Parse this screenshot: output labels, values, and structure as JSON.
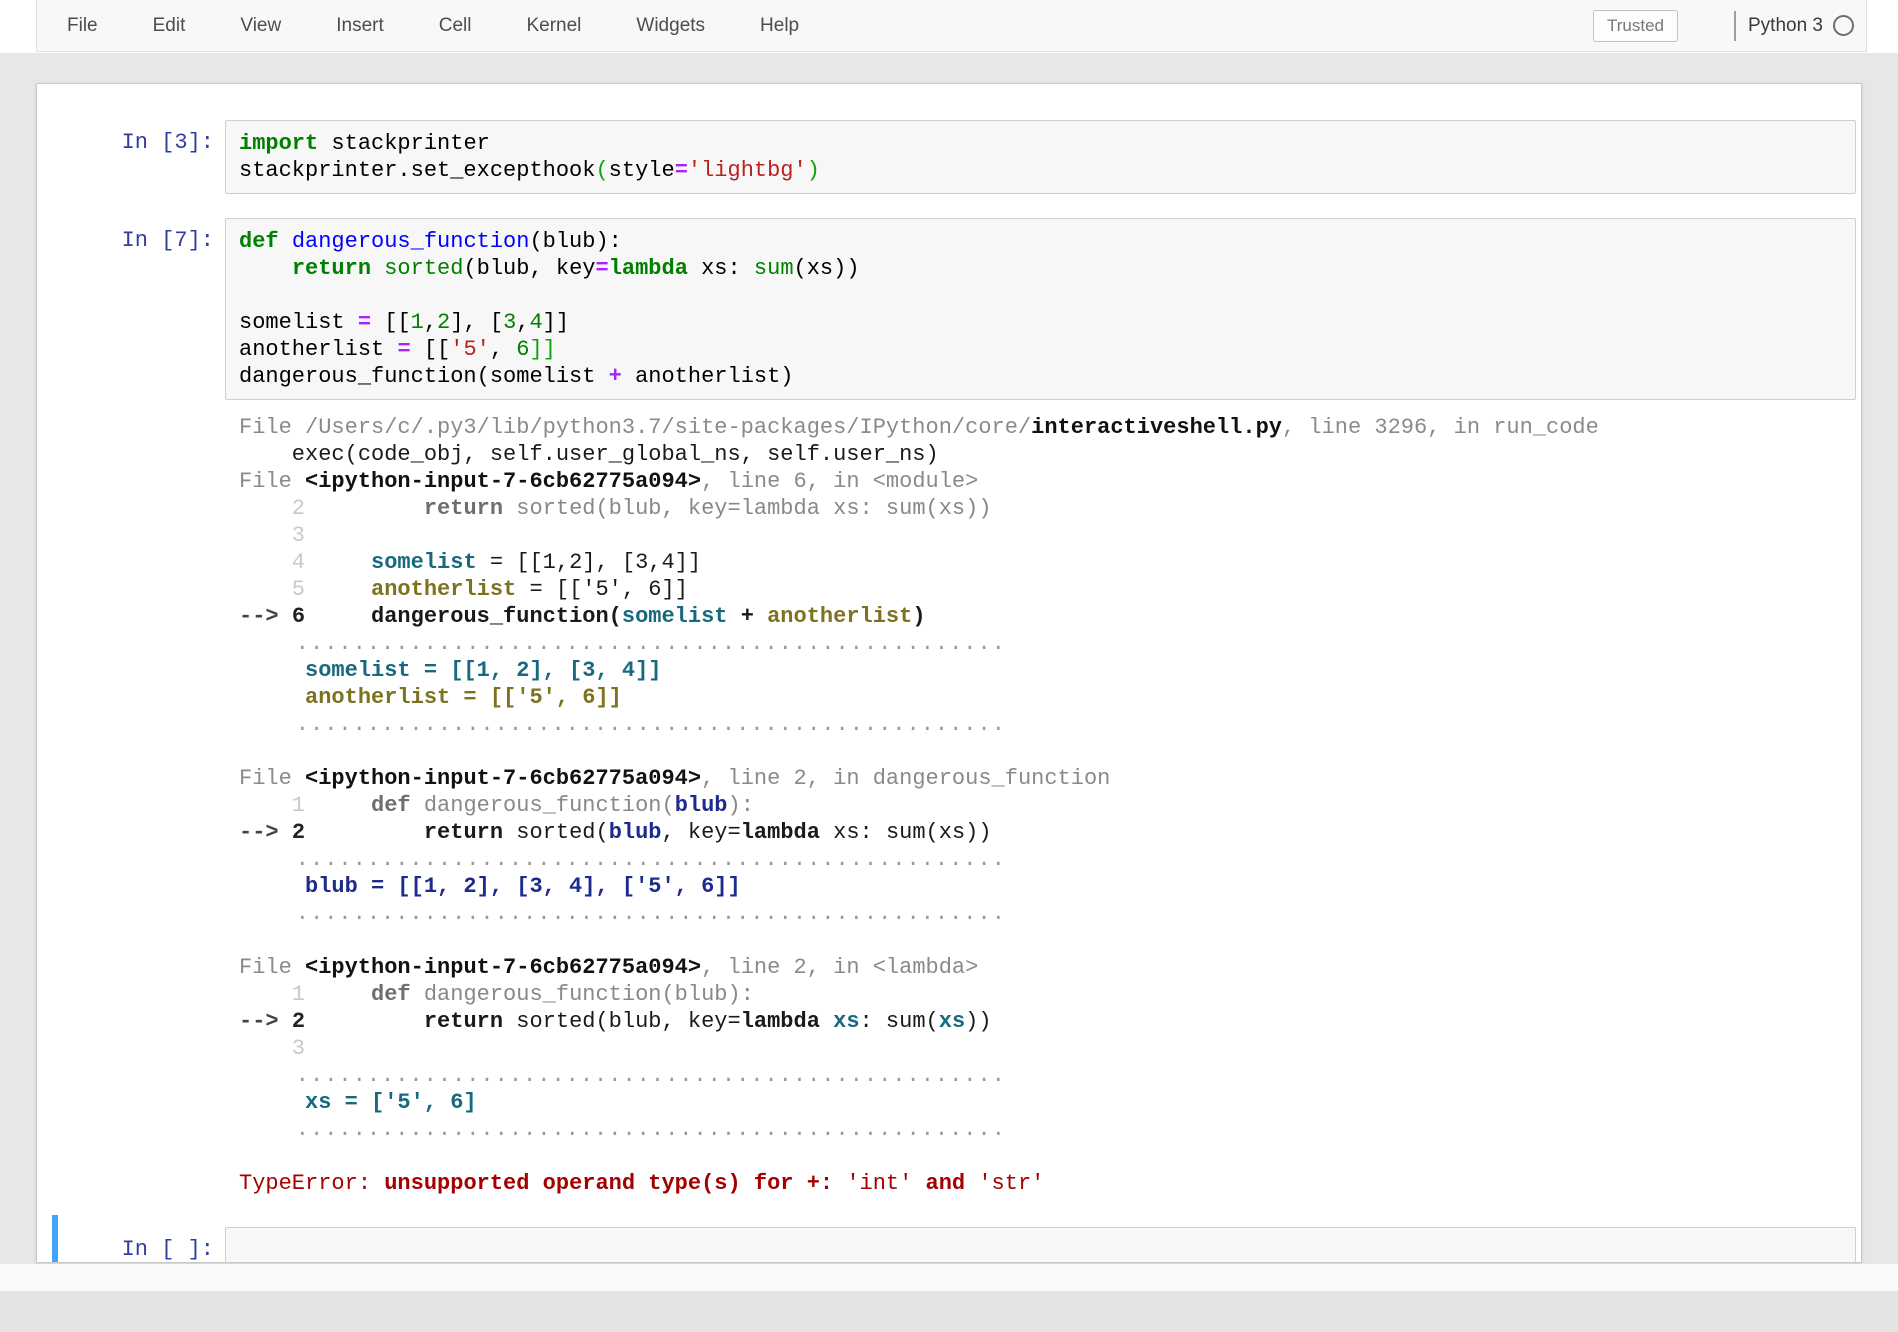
{
  "menubar": {
    "items": [
      {
        "id": "file",
        "label": "File"
      },
      {
        "id": "edit",
        "label": "Edit"
      },
      {
        "id": "view",
        "label": "View"
      },
      {
        "id": "insert",
        "label": "Insert"
      },
      {
        "id": "cell",
        "label": "Cell"
      },
      {
        "id": "kernel",
        "label": "Kernel"
      },
      {
        "id": "widgets",
        "label": "Widgets"
      },
      {
        "id": "help",
        "label": "Help"
      }
    ],
    "trusted_label": "Trusted",
    "kernel_name": "Python 3"
  },
  "colors": {
    "selected_cell_bar": "#42a5f5",
    "prompt_blue": "#303f9f",
    "keyword_green": "#008000",
    "string_red": "#ba2121",
    "operator_purple": "#aa22ff",
    "var_teal": "#17697d",
    "var_olive": "#7d721e",
    "var_navy": "#1c2b8d",
    "error_red": "#a40000"
  },
  "cells": [
    {
      "prompt": "In [3]:",
      "code": [
        [
          [
            "kw",
            "import"
          ],
          [
            "p",
            " stackprinter"
          ]
        ],
        [
          [
            "p",
            "stackprinter.set_excepthook"
          ],
          [
            "mb",
            "("
          ],
          [
            "p",
            "style"
          ],
          [
            "op",
            "="
          ],
          [
            "str",
            "'lightbg'"
          ],
          [
            "mb",
            ")"
          ]
        ]
      ]
    },
    {
      "prompt": "In [7]:",
      "code": [
        [
          [
            "kw",
            "def"
          ],
          [
            "p",
            " "
          ],
          [
            "fn",
            "dangerous_function"
          ],
          [
            "p",
            "(blub):"
          ]
        ],
        [
          [
            "p",
            "    "
          ],
          [
            "kw",
            "return"
          ],
          [
            "p",
            " "
          ],
          [
            "bi",
            "sorted"
          ],
          [
            "p",
            "(blub, key"
          ],
          [
            "op",
            "="
          ],
          [
            "kw",
            "lambda"
          ],
          [
            "p",
            " xs: "
          ],
          [
            "bi",
            "sum"
          ],
          [
            "p",
            "(xs))"
          ]
        ],
        [],
        [
          [
            "p",
            "somelist "
          ],
          [
            "op",
            "="
          ],
          [
            "p",
            " [["
          ],
          [
            "num",
            "1"
          ],
          [
            "p",
            ","
          ],
          [
            "num",
            "2"
          ],
          [
            "p",
            "], ["
          ],
          [
            "num",
            "3"
          ],
          [
            "p",
            ","
          ],
          [
            "num",
            "4"
          ],
          [
            "p",
            "]]"
          ]
        ],
        [
          [
            "p",
            "anotherlist "
          ],
          [
            "op",
            "="
          ],
          [
            "p",
            " [["
          ],
          [
            "str",
            "'5'"
          ],
          [
            "p",
            ", "
          ],
          [
            "num",
            "6"
          ],
          [
            "mb",
            "]]"
          ]
        ],
        [
          [
            "p",
            "dangerous_function(somelist "
          ],
          [
            "op",
            "+"
          ],
          [
            "p",
            " anotherlist)"
          ]
        ]
      ],
      "output": [
        [
          [
            "gy",
            "File /Users/c/.py3/lib/python3.7/site-packages/IPython/core/"
          ],
          [
            "fileb",
            "interactiveshell.py"
          ],
          [
            "gy",
            ", line 3296, in run_code"
          ]
        ],
        [
          [
            "cur",
            "    exec(code_obj, self.user_global_ns, self.user_ns)"
          ]
        ],
        [
          [
            "gy",
            "File "
          ],
          [
            "fileb",
            "<ipython-input-7-6cb62775a094>"
          ],
          [
            "gy",
            ", line 6, in <module>"
          ]
        ],
        [
          [
            "lno",
            "    2"
          ],
          [
            "p",
            "     "
          ],
          [
            "ctx",
            "    "
          ],
          [
            "ctxb",
            "return"
          ],
          [
            "ctx",
            " sorted(blub, key=lambda xs: sum(xs))"
          ]
        ],
        [
          [
            "lno",
            "    3"
          ]
        ],
        [
          [
            "lno",
            "    4"
          ],
          [
            "p",
            "     "
          ],
          [
            "teal",
            "somelist"
          ],
          [
            "cur",
            " = [[1,2], [3,4]]"
          ]
        ],
        [
          [
            "lno",
            "    5"
          ],
          [
            "p",
            "     "
          ],
          [
            "olive",
            "anotherlist"
          ],
          [
            "cur",
            " = [['5', 6]]"
          ]
        ],
        [
          [
            "arr",
            "--> "
          ],
          [
            "lnoc",
            "6"
          ],
          [
            "p",
            "     "
          ],
          [
            "curb",
            "dangerous_function("
          ],
          [
            "teal",
            "somelist"
          ],
          [
            "curb",
            " + "
          ],
          [
            "olive",
            "anotherlist"
          ],
          [
            "curb",
            ")"
          ]
        ],
        [
          [
            "dots",
            "    .................................................."
          ]
        ],
        [
          [
            "teal",
            "     somelist = [[1, 2], [3, 4]]"
          ]
        ],
        [
          [
            "olive",
            "     anotherlist = [['5', 6]]"
          ]
        ],
        [
          [
            "dots",
            "    .................................................."
          ]
        ],
        [],
        [
          [
            "gy",
            "File "
          ],
          [
            "fileb",
            "<ipython-input-7-6cb62775a094>"
          ],
          [
            "gy",
            ", line 2, in dangerous_function"
          ]
        ],
        [
          [
            "lno",
            "    1"
          ],
          [
            "p",
            "     "
          ],
          [
            "ctxb",
            "def"
          ],
          [
            "ctx",
            " dangerous_function("
          ],
          [
            "navy",
            "blub"
          ],
          [
            "ctx",
            "):"
          ]
        ],
        [
          [
            "arr",
            "--> "
          ],
          [
            "lnoc",
            "2"
          ],
          [
            "p",
            "     "
          ],
          [
            "cur",
            "    "
          ],
          [
            "curb",
            "return"
          ],
          [
            "cur",
            " sorted("
          ],
          [
            "navy",
            "blub"
          ],
          [
            "cur",
            ", key="
          ],
          [
            "curb",
            "lambda"
          ],
          [
            "cur",
            " xs: sum(xs))"
          ]
        ],
        [
          [
            "dots",
            "    .................................................."
          ]
        ],
        [
          [
            "navy",
            "     blub = [[1, 2], [3, 4], ['5', 6]]"
          ]
        ],
        [
          [
            "dots",
            "    .................................................."
          ]
        ],
        [],
        [
          [
            "gy",
            "File "
          ],
          [
            "fileb",
            "<ipython-input-7-6cb62775a094>"
          ],
          [
            "gy",
            ", line 2, in <lambda>"
          ]
        ],
        [
          [
            "lno",
            "    1"
          ],
          [
            "p",
            "     "
          ],
          [
            "ctxb",
            "def"
          ],
          [
            "ctx",
            " dangerous_function(blub):"
          ]
        ],
        [
          [
            "arr",
            "--> "
          ],
          [
            "lnoc",
            "2"
          ],
          [
            "p",
            "     "
          ],
          [
            "cur",
            "    "
          ],
          [
            "curb",
            "return"
          ],
          [
            "cur",
            " sorted(blub, key="
          ],
          [
            "curb",
            "lambda"
          ],
          [
            "cur",
            " "
          ],
          [
            "teal",
            "xs"
          ],
          [
            "cur",
            ": sum("
          ],
          [
            "teal",
            "xs"
          ],
          [
            "cur",
            "))"
          ]
        ],
        [
          [
            "lno",
            "    3"
          ]
        ],
        [
          [
            "dots",
            "    .................................................."
          ]
        ],
        [
          [
            "teal",
            "     xs = ['5', 6]"
          ]
        ],
        [
          [
            "dots",
            "    .................................................."
          ]
        ],
        [],
        [
          [
            "err",
            "TypeError: "
          ],
          [
            "errb",
            "unsupported operand type(s) for +: "
          ],
          [
            "err",
            "'int'"
          ],
          [
            "errb",
            " and "
          ],
          [
            "err",
            "'str'"
          ]
        ]
      ]
    },
    {
      "prompt": "In [ ]:",
      "code": []
    }
  ]
}
